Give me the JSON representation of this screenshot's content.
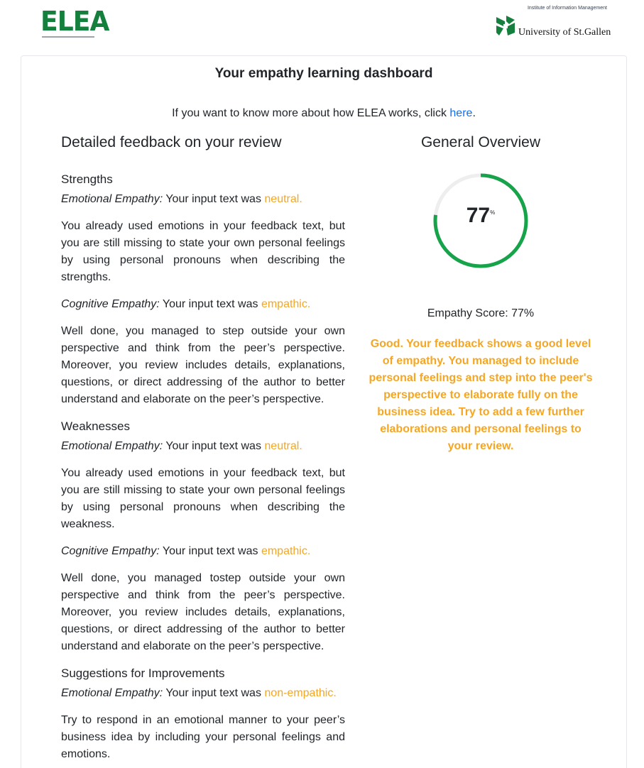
{
  "header": {
    "app_logo": "ELEA",
    "university_name": "University of St.Gallen",
    "institute": "Institute of Information Management"
  },
  "dashboard": {
    "title": "Your empathy learning dashboard",
    "intro_text": "If you want to know more about how ELEA works, click ",
    "intro_link": "here",
    "intro_suffix": "."
  },
  "feedback": {
    "heading": "Detailed feedback on your review",
    "sections": [
      {
        "title": "Strengths",
        "emotional_label": "Emotional Empathy:",
        "emotional_prefix": " Your input text was ",
        "emotional_value": "neutral.",
        "emotional_text": "You already used emotions in your feedback text, but you are still missing to state your own personal feelings by using personal pronouns when describing the strengths.",
        "cognitive_label": "Cognitive Empathy:",
        "cognitive_prefix": " Your input text was ",
        "cognitive_value": "empathic.",
        "cognitive_text": "Well done, you managed to step outside your own perspective and think from the peer’s perspective. Moreover, you review includes details, explanations, questions, or direct addressing of the author to better understand and elaborate on the peer’s perspective."
      },
      {
        "title": "Weaknesses",
        "emotional_label": "Emotional Empathy:",
        "emotional_prefix": " Your input text was ",
        "emotional_value": "neutral.",
        "emotional_text": "You already used emotions in your feedback text, but you are still missing to state your own personal feelings by using personal pronouns when describing the weakness.",
        "cognitive_label": "Cognitive Empathy:",
        "cognitive_prefix": " Your input text was ",
        "cognitive_value": "empathic.",
        "cognitive_text": "Well done, you managed tostep outside your own perspective and think from the peer’s perspective. Moreover, you review includes details, explanations, questions, or direct addressing of the author to better understand and elaborate on the peer’s perspective."
      },
      {
        "title": "Suggestions for Improvements",
        "emotional_label": "Emotional Empathy:",
        "emotional_prefix": " Your input text was ",
        "emotional_value": "non-empathic.",
        "emotional_text": "Try to respond in an emotional manner to your peer’s business idea by including your personal feelings and emotions."
      }
    ]
  },
  "overview": {
    "heading": "General Overview",
    "score_value": "77",
    "score_unit": "%",
    "score_fraction": 0.77,
    "score_label": "Empathy Score: 77%",
    "score_message": "Good. Your feedback shows a good level of empathy. You managed to include personal feelings and step into the peer's perspective to elaborate fully on the business idea. Try to add a few further elaborations and personal feelings to your review."
  },
  "colors": {
    "brand_green": "#15803d",
    "gauge_green": "#16a34a",
    "gauge_track": "#eeeeee",
    "accent_orange": "#f5a623",
    "link_blue": "#0d6efd"
  }
}
